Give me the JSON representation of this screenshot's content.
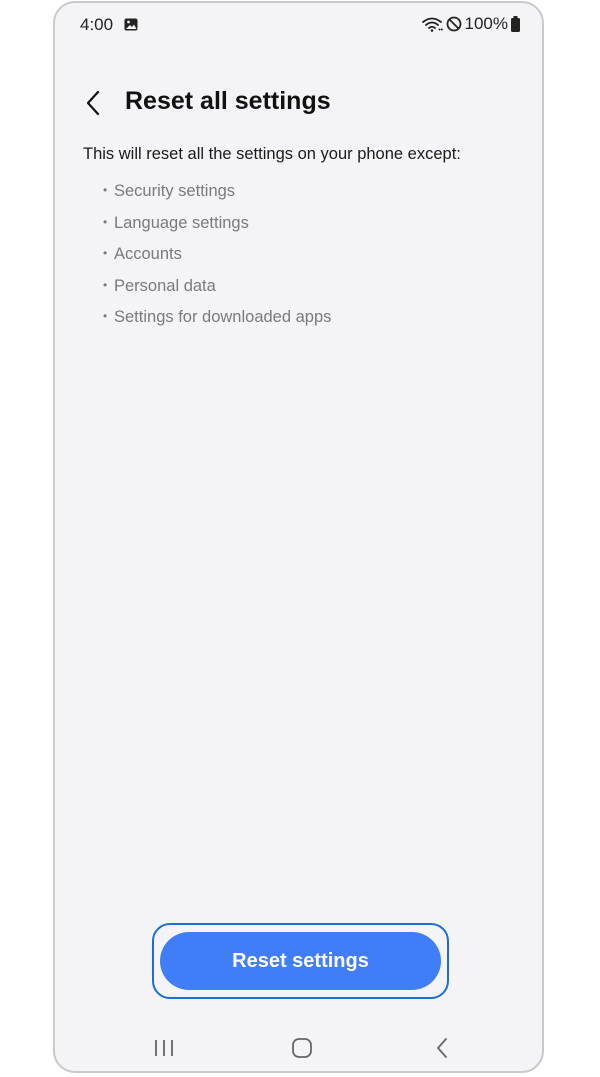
{
  "status_bar": {
    "time": "4:00",
    "battery": "100%",
    "icons": [
      "gallery-icon",
      "wifi-icon",
      "do-not-disturb-icon",
      "battery-icon"
    ]
  },
  "header": {
    "title": "Reset all settings",
    "back_icon": "chevron-left-icon"
  },
  "content": {
    "description": "This will reset all the settings on your phone except:",
    "exceptions": [
      "Security settings",
      "Language settings",
      "Accounts",
      "Personal data",
      "Settings for downloaded apps"
    ]
  },
  "actions": {
    "reset_label": "Reset settings"
  },
  "nav_bar": {
    "icons": [
      "recents-icon",
      "home-icon",
      "back-icon"
    ]
  },
  "colors": {
    "background": "#f4f4f7",
    "accent": "#3f7ef6",
    "highlight": "#1a6fd4",
    "secondary_text": "#7a7a7e"
  }
}
